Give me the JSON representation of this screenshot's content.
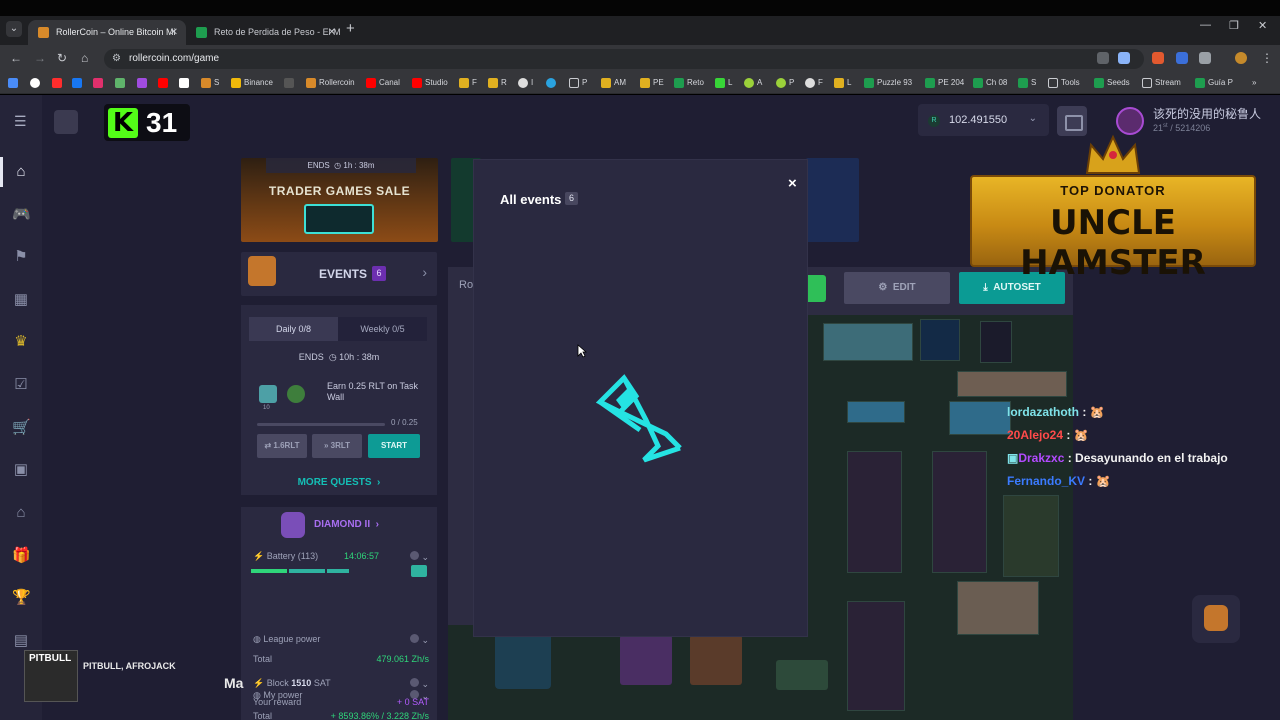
{
  "browser": {
    "tabs": [
      {
        "title": "RollerCoin – Online Bitcoin Mi",
        "active": true
      },
      {
        "title": "Reto de Perdida de Peso - El M",
        "active": false
      }
    ],
    "url": "rollercoin.com/game",
    "bookmarks": [
      "S",
      "Binance",
      "Rollercoin",
      "Canal",
      "Studio",
      "F",
      "R",
      "I",
      "P",
      "AM",
      "PE",
      "Reto",
      "L",
      "A",
      "P",
      "F",
      "L",
      "Puzzle 93",
      "PE 204",
      "Ch 08",
      "S",
      "Tools",
      "Seeds",
      "Stream",
      "Guía P"
    ],
    "more_bookmarks": "»"
  },
  "header": {
    "ticker_value": "31",
    "balance_currency": "R",
    "balance": "102.491550",
    "username": "该死的没用的秘鲁人",
    "rank": "21",
    "rank_total": "/ 5214206"
  },
  "banner": {
    "ends": "ENDS",
    "ends_time": "1h : 38m",
    "title": "TRADER GAMES SALE"
  },
  "events": {
    "label": "EVENTS",
    "count": "6"
  },
  "quests": {
    "tab_daily": "Daily 0/8",
    "tab_weekly": "Weekly 0/5",
    "ends_label": "ENDS",
    "ends_time": "10h : 38m",
    "task_text": "Earn 0.25 RLT on Task Wall",
    "task_icon_amount": "10",
    "progress": "0 / 0.25",
    "progress_fraction": 0,
    "btn1": "1.6RLT",
    "btn2": "3RLT",
    "btn_start": "START",
    "more": "MORE QUESTS"
  },
  "league": {
    "name": "DIAMOND II",
    "battery_label": "Battery (113)",
    "battery_time": "14:06:57",
    "my_power_label": "My power",
    "total_label": "Total",
    "my_power_total": "+ 8593.86% / 3.228 Zh/s",
    "league_power_label": "League power",
    "league_total": "479.061 Zh/s",
    "block_label": "Block",
    "block_value": "1510",
    "block_unit": "SAT",
    "reward_label": "Your reward",
    "reward_value": "+ 0 SAT"
  },
  "room": {
    "edit": "EDIT",
    "autoset": "AUTOSET",
    "side_tab": "Ro"
  },
  "donator": {
    "top": "TOP DONATOR",
    "name": "UNCLE HAMSTER"
  },
  "chat": [
    {
      "user": "lordazathoth",
      "sep": " :",
      "msg": "",
      "color": "#7fe3e9"
    },
    {
      "user": "20Alejo24",
      "sep": " :",
      "msg": "",
      "color": "#ff4a4a"
    },
    {
      "user": "Drakzxc",
      "sep": " : ",
      "msg": "Desayunando en el trabajo",
      "color": "#b34bff"
    },
    {
      "user": "Fernando_KV",
      "sep": " :",
      "msg": "",
      "color": "#3b7bff"
    }
  ],
  "music": {
    "cover_text": "PITBULL",
    "artist": "PITBULL, AFROJACK",
    "ticker": "Ma"
  },
  "modal": {
    "title": "All events",
    "count": "6",
    "close": "×"
  },
  "colors": {
    "accent_teal": "#0d9b95",
    "loader_cyan": "#25e3e3",
    "panel": "#2a2940",
    "background": "#1f1e33"
  }
}
